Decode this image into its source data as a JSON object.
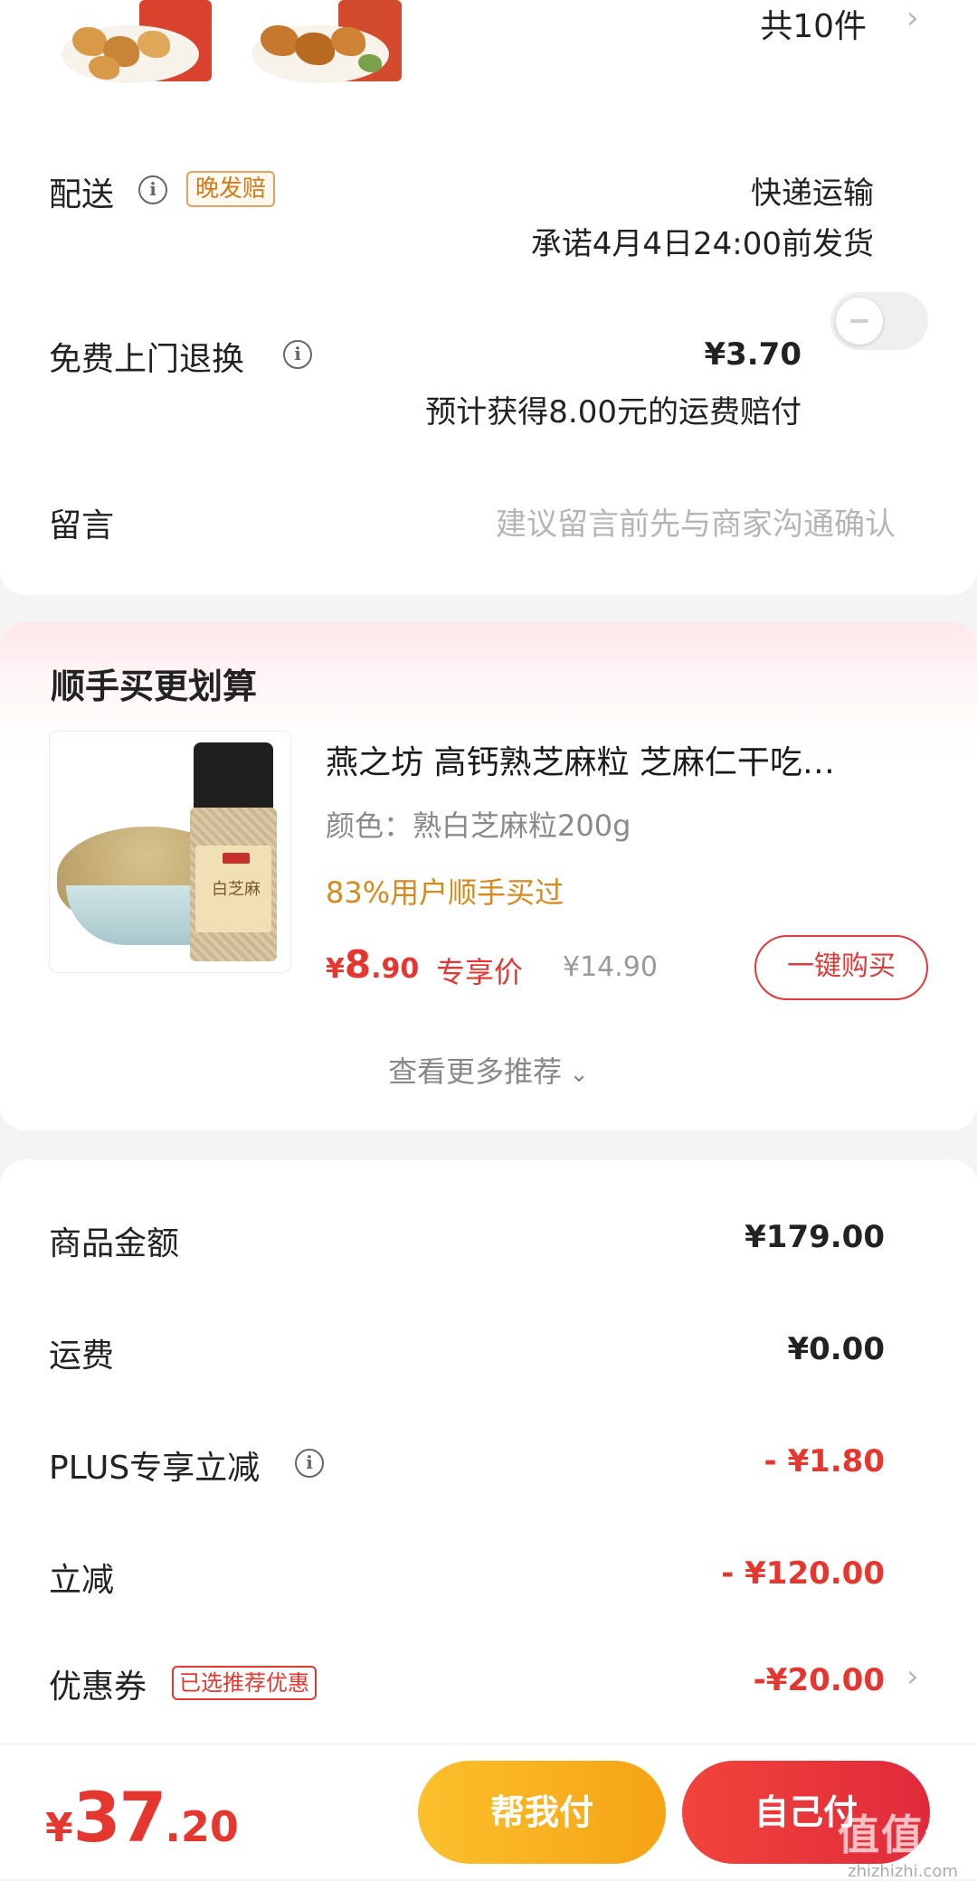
{
  "order": {
    "item_count": "共10件",
    "delivery": {
      "label": "配送",
      "tag": "晚发赔",
      "method": "快递运输",
      "promise": "承诺4月4日24:00前发货"
    },
    "return_service": {
      "label": "免费上门退换",
      "price": "¥3.70",
      "note": "预计获得8.00元的运费赔付",
      "enabled": false
    },
    "message": {
      "label": "留言",
      "placeholder": "建议留言前先与商家沟通确认"
    }
  },
  "upsell": {
    "title": "顺手买更划算",
    "product": {
      "name": "燕之坊 高钙熟芝麻粒 芝麻仁干吃…",
      "variant": "颜色：熟白芝麻粒200g",
      "social_proof": "83%用户顺手买过",
      "price_symbol": "¥",
      "price_int": "8",
      "price_dec": ".90",
      "price_tag": "专享价",
      "original_price": "¥14.90",
      "jar_text": "白芝麻",
      "buy_button": "一键购买"
    },
    "more": "查看更多推荐"
  },
  "summary": {
    "rows": [
      {
        "label": "商品金额",
        "value": "¥179.00"
      },
      {
        "label": "运费",
        "value": "¥0.00"
      },
      {
        "label": "PLUS专享立减",
        "value": "- ¥1.80"
      },
      {
        "label": "立减",
        "value": "- ¥120.00"
      },
      {
        "label": "优惠券",
        "tag": "已选推荐优惠",
        "value": "-¥20.00"
      }
    ]
  },
  "bottom": {
    "total_symbol": "¥",
    "total_int": "37",
    "total_dec": ".20",
    "help_pay": "帮我付",
    "self_pay": "自己付",
    "watermark_logo": "值值值",
    "watermark_url": "zhizhizhi.com"
  },
  "colors": {
    "accent_red": "#e5372f",
    "orange": "#f5a623",
    "tag_orange": "#d67a19"
  }
}
